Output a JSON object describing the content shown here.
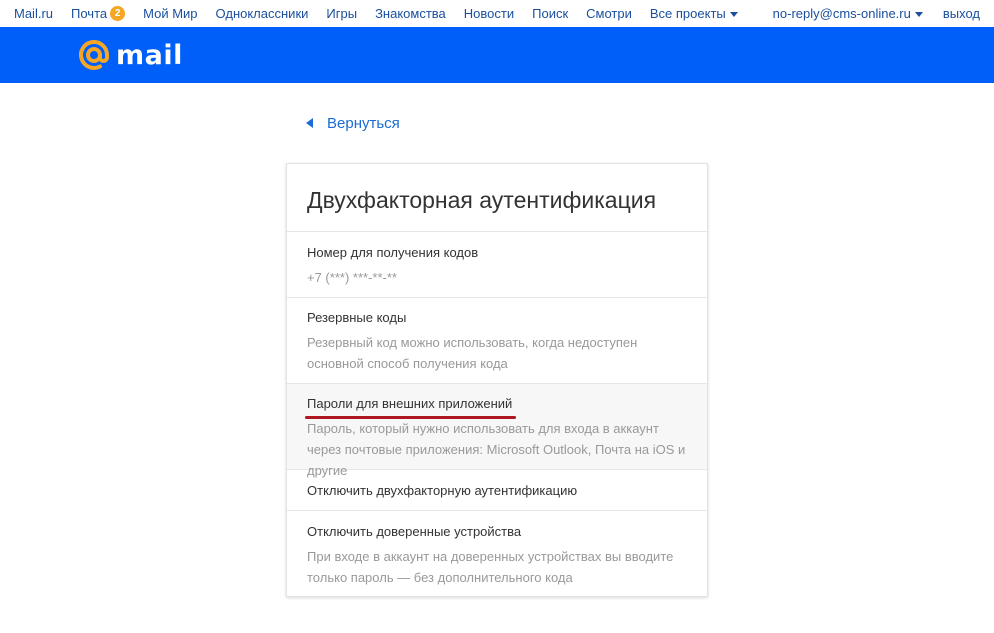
{
  "portal": {
    "left": [
      {
        "label": "Mail.ru"
      },
      {
        "label": "Почта",
        "badge": "2"
      },
      {
        "label": "Мой Мир"
      },
      {
        "label": "Одноклассники"
      },
      {
        "label": "Игры"
      },
      {
        "label": "Знакомства"
      },
      {
        "label": "Новости"
      },
      {
        "label": "Поиск"
      },
      {
        "label": "Смотри"
      },
      {
        "label": "Все проекты"
      }
    ],
    "account": "no-reply@cms-online.ru",
    "logout": "выход"
  },
  "header": {
    "logo_text": "mail",
    "bg_color": "#005ff9",
    "logo_accent": "#f5a623"
  },
  "back_link": "Вернуться",
  "card": {
    "title": "Двухфакторная аутентификация",
    "phone": {
      "label": "Номер для получения кодов",
      "value": "+7 (***) ***-**-**"
    },
    "backup": {
      "label": "Резервные коды",
      "desc": "Резервный код можно использовать, когда недоступен основной способ получения кода"
    },
    "apps": {
      "label": "Пароли для внешних приложений",
      "desc": "Пароль, который нужно использовать для входа в аккаунт через почтовые приложения: Microsoft Outlook, Почта на iOS и другие"
    },
    "disable": {
      "label": "Отключить двухфакторную аутентификацию"
    },
    "trusted": {
      "label": "Отключить доверенные устройства",
      "desc": "При входе в аккаунт на доверенных устройствах вы вводите только пароль — без дополнительного кода"
    }
  }
}
